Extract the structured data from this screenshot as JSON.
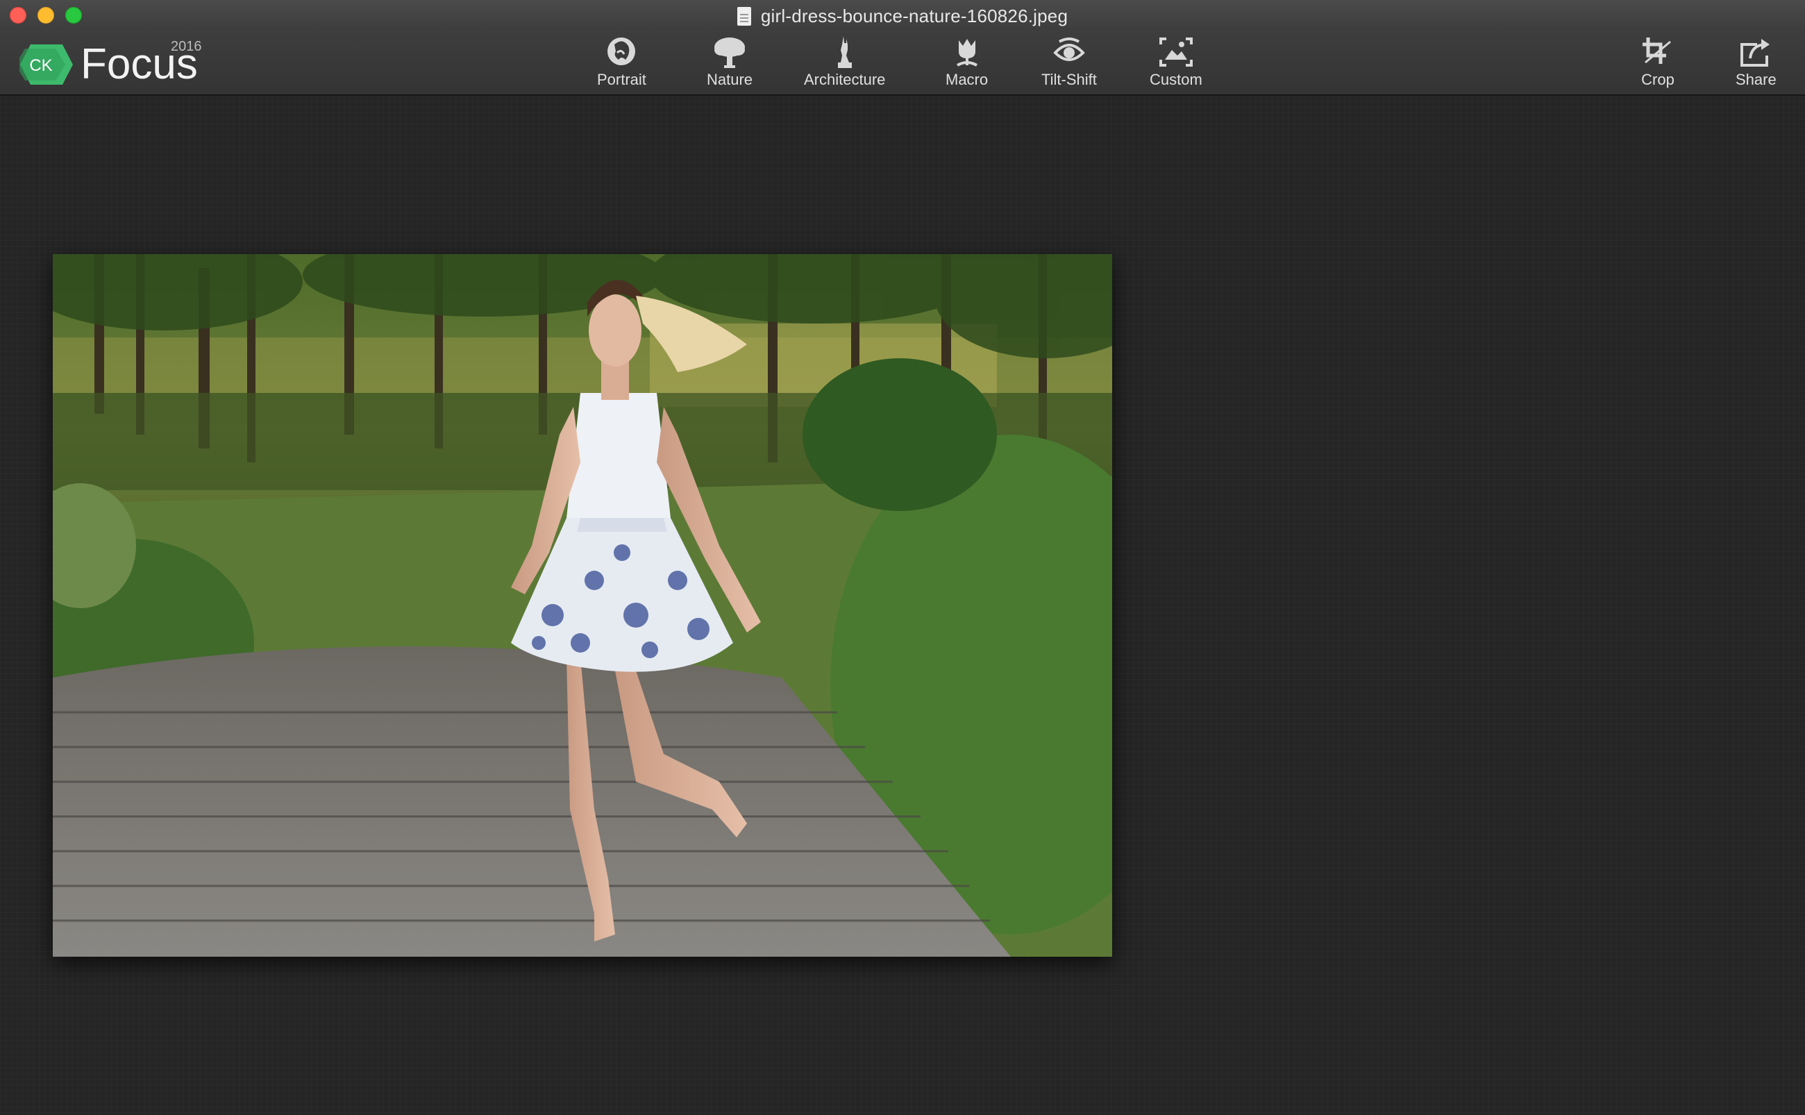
{
  "window": {
    "title": "girl-dress-bounce-nature-160826.jpeg",
    "traffic_lights": [
      "close",
      "minimize",
      "zoom"
    ]
  },
  "app": {
    "logo_badge": "CK",
    "name": "Focus",
    "year": "2016",
    "accent": "#3dba6c"
  },
  "toolbar": {
    "presets": [
      {
        "label": "Portrait",
        "icon": "portrait-icon"
      },
      {
        "label": "Nature",
        "icon": "tree-icon"
      },
      {
        "label": "Architecture",
        "icon": "statue-icon"
      },
      {
        "label": "Macro",
        "icon": "tulip-icon"
      },
      {
        "label": "Tilt-Shift",
        "icon": "eye-icon"
      },
      {
        "label": "Custom",
        "icon": "custom-frame-icon"
      }
    ],
    "crop_label": "Crop",
    "share_label": "Share"
  },
  "canvas": {
    "photo_description": "Woman in white dress with blue flowers dancing barefoot on wooden boardwalk in a green park"
  }
}
